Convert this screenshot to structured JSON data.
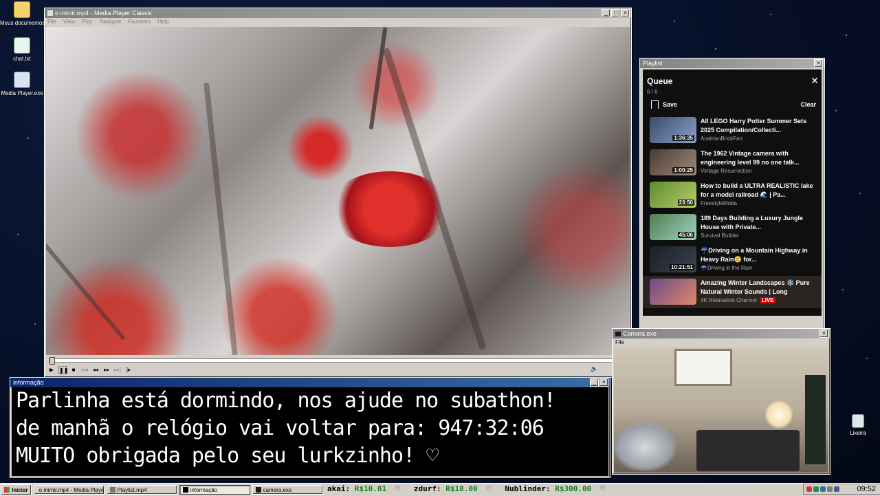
{
  "desktop": {
    "icons": [
      {
        "label": "Meus documentos",
        "icon": "folder-icon"
      },
      {
        "label": "chat.txt",
        "icon": "text-file-icon"
      },
      {
        "label": "Media Player.exe",
        "icon": "media-player-icon"
      },
      {
        "label": "Lixeira",
        "icon": "recycle-bin-icon"
      }
    ]
  },
  "media_player": {
    "title": "o mimir.mp4 - Media Player Classic",
    "menu": [
      "File",
      "View",
      "Play",
      "Navigate",
      "Favorites",
      "Help"
    ],
    "progress": 0.0,
    "controls": [
      "play",
      "pause",
      "stop",
      "prev",
      "rewind",
      "forward",
      "next",
      "frame-step"
    ]
  },
  "playlist": {
    "window_title": "Playlist",
    "heading": "Queue",
    "count": "6 / 6",
    "save_label": "Save",
    "clear_label": "Clear",
    "items": [
      {
        "title": "All LEGO Harry Potter Summer Sets 2025 Compilation/Collecti...",
        "channel": "AustrianBrickFan",
        "duration": "1:36:35",
        "thumb": "#3b4a6b"
      },
      {
        "title": "The 1962 Vintage camera with engineering level 99 no one talk...",
        "channel": "Vintage Resurrection",
        "duration": "1:00:25",
        "thumb": "#4a3a33"
      },
      {
        "title": "How to build a ULTRA REALISTIC lake for a model railroad 🌊 | Pa...",
        "channel": "FreestyleMoba",
        "duration": "23:50",
        "thumb": "#5e8a2e"
      },
      {
        "title": "189 Days Building a Luxury Jungle House with Private...",
        "channel": "Survival Builder",
        "duration": "45:06",
        "thumb": "#4e7e52"
      },
      {
        "title": "☔Driving on a Mountain Highway in Heavy Rain🙂 for...",
        "channel": "☔Driving in the Rain",
        "duration": "10:21:51",
        "thumb": "#1c2026"
      },
      {
        "title": "Amazing Winter Landscapes ❄️ Pure Natural Winter Sounds | Long Relaxing...",
        "channel": "4K Relaxation Channel",
        "duration": "",
        "live": "LIVE",
        "thumb": "#6b4a8a"
      }
    ]
  },
  "info_window": {
    "title": "informação",
    "lines": [
      "Parlinha está dormindo, nos ajude no subathon!",
      "de manhã o relógio vai voltar para:  947:32:06",
      "MUITO obrigada pelo seu lurkzinho! ♡"
    ]
  },
  "camera": {
    "title": "Camera.exe",
    "menu": "File"
  },
  "taskbar": {
    "start_label": "Iniciar",
    "tasks": [
      {
        "label": "o mimir.mp4 - Media Playe...",
        "active": false
      },
      {
        "label": "Playlist.mp4",
        "active": false
      },
      {
        "label": "informação",
        "active": true
      },
      {
        "label": "camera.exe",
        "active": false
      }
    ],
    "ticker": [
      {
        "name": "akai:",
        "amount": "R$10.01"
      },
      {
        "name": "zdurf:",
        "amount": "R$10.00"
      },
      {
        "name": "Nublinder:",
        "amount": "R$300.00"
      }
    ],
    "clock": "09:52"
  }
}
